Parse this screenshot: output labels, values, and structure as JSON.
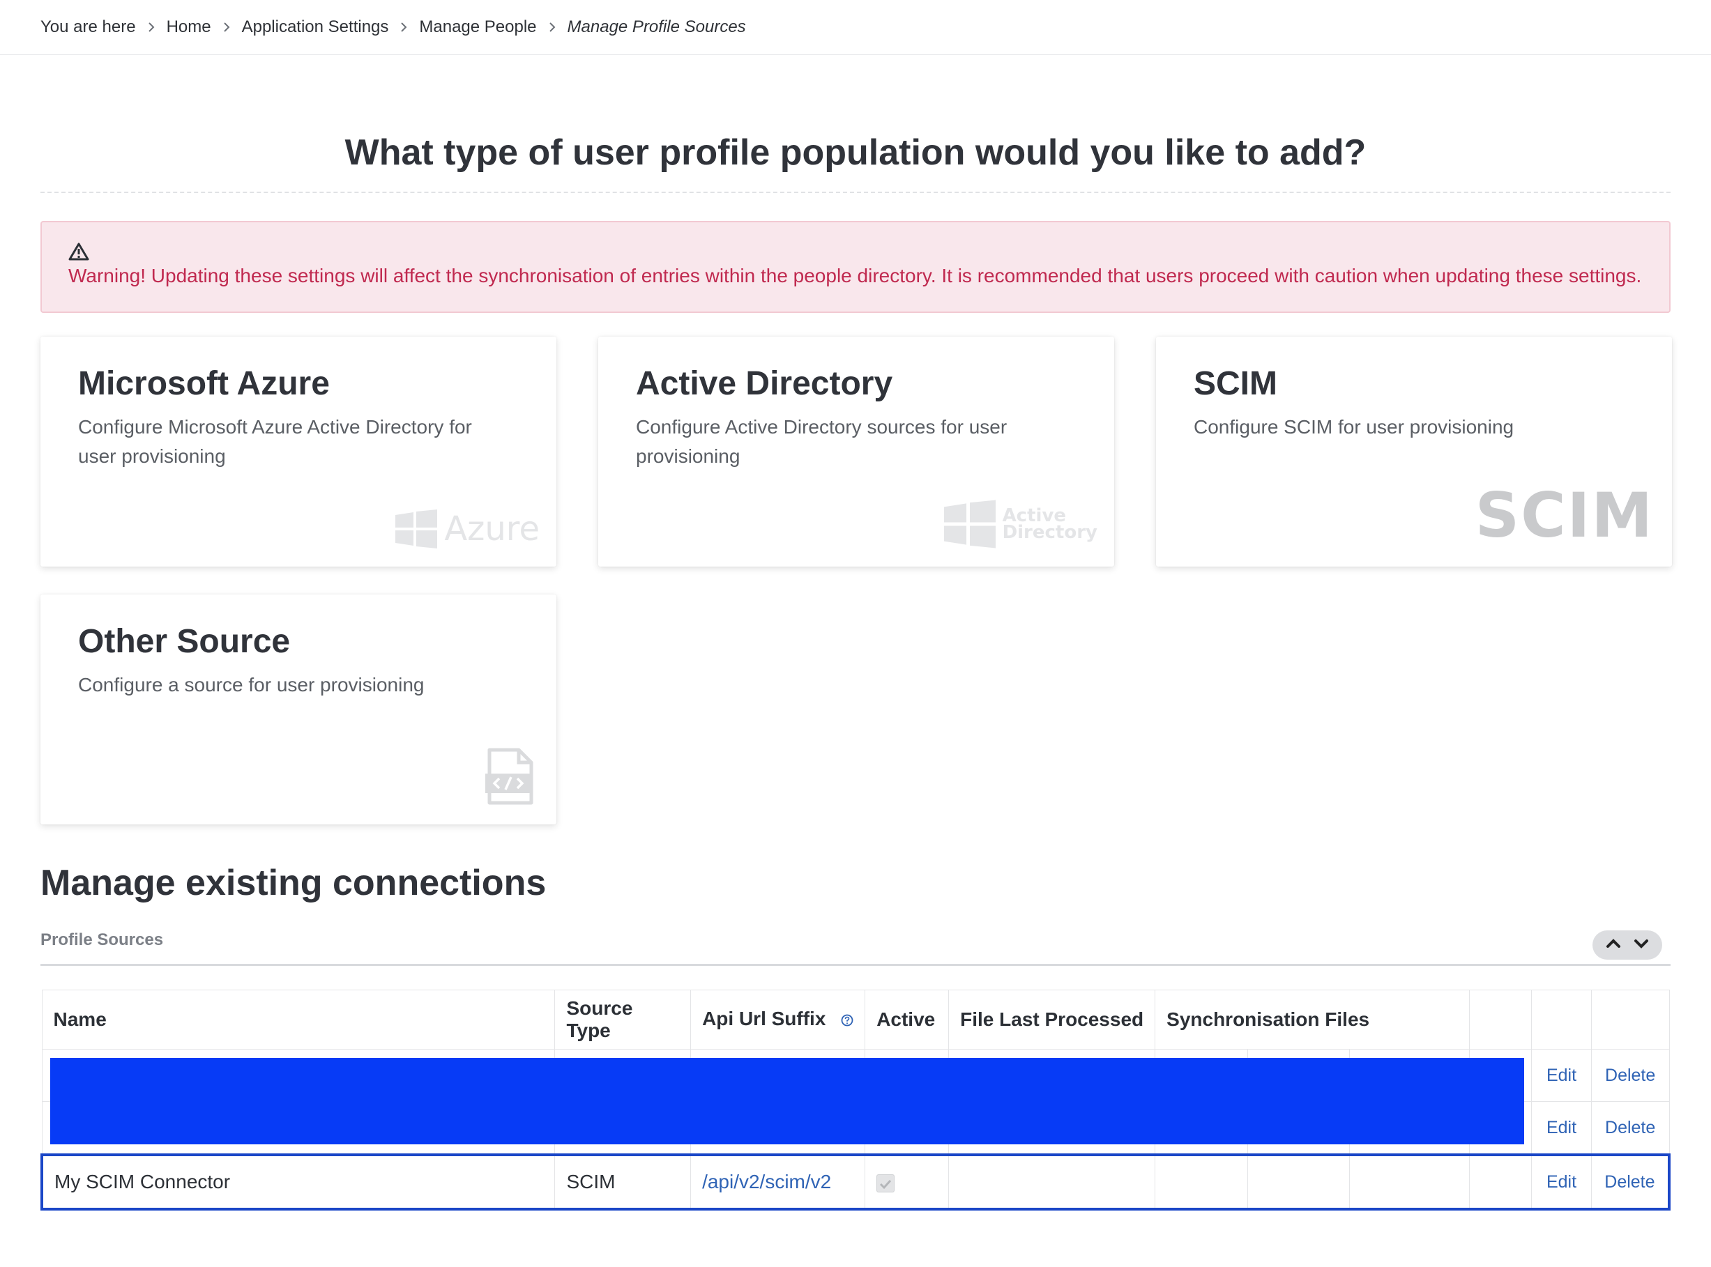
{
  "breadcrumb": {
    "items": [
      "You are here",
      "Home",
      "Application Settings",
      "Manage People"
    ],
    "current": "Manage Profile Sources"
  },
  "question": "What type of user profile population would you like to add?",
  "warning": "Warning! Updating these settings will affect the synchronisation of entries within the people directory. It is recommended that users proceed with caution when updating these settings.",
  "cards": [
    {
      "title": "Microsoft Azure",
      "desc": "Configure Microsoft Azure Active Directory for user provisioning",
      "logo": "Azure"
    },
    {
      "title": "Active Directory",
      "desc": "Configure Active Directory sources for user provisioning",
      "logo_line1": "Active",
      "logo_line2": "Directory"
    },
    {
      "title": "SCIM",
      "desc": "Configure SCIM for user provisioning",
      "logo": "SCIM"
    },
    {
      "title": "Other Source",
      "desc": "Configure a source for user provisioning",
      "logo": "code-file-icon"
    }
  ],
  "manage_title": "Manage existing connections",
  "section_label": "Profile Sources",
  "table": {
    "headers": [
      "Name",
      "Source Type",
      "Api Url Suffix",
      "Active",
      "File Last Processed",
      "Synchronisation Files"
    ],
    "edit_label": "Edit",
    "delete_label": "Delete",
    "row3": {
      "name": "My SCIM Connector",
      "source_type": "SCIM",
      "api_url_suffix": "/api/v2/scim/v2",
      "active": true
    }
  },
  "colors": {
    "warning_text": "#c0294f",
    "warning_bg": "#f9e7ec",
    "link": "#2f63b5",
    "redaction": "#073bf6",
    "highlight": "#1a46c7"
  }
}
